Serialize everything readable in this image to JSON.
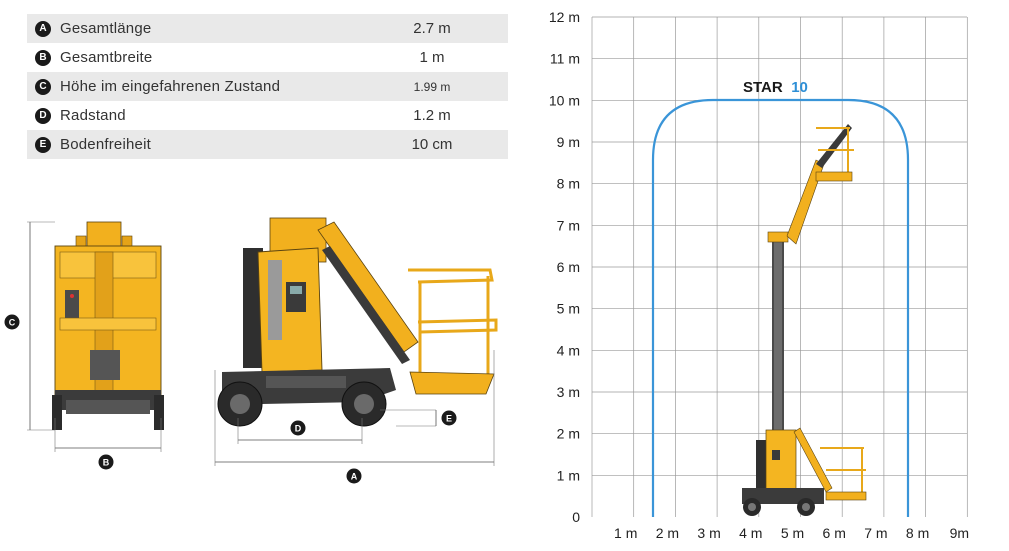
{
  "specs": [
    {
      "letter": "A",
      "label": "Gesamtlänge",
      "value": "2.7 m"
    },
    {
      "letter": "B",
      "label": "Gesamtbreite",
      "value": "1 m"
    },
    {
      "letter": "C",
      "label": "Höhe im eingefahrenen Zustand",
      "value": "1.99 m"
    },
    {
      "letter": "D",
      "label": "Radstand",
      "value": "1.2 m"
    },
    {
      "letter": "E",
      "label": "Bodenfreiheit",
      "value": "10 cm"
    }
  ],
  "dimension_markers": {
    "a": "A",
    "b": "B",
    "c": "C",
    "d": "D",
    "e": "E"
  },
  "chart": {
    "brand_name": "STAR",
    "brand_number": "10",
    "y_ticks": [
      "0",
      "1 m",
      "2 m",
      "3 m",
      "4 m",
      "5 m",
      "6 m",
      "7 m",
      "8 m",
      "9 m",
      "10 m",
      "11 m",
      "12 m"
    ],
    "x_ticks": [
      "1 m",
      "2 m",
      "3 m",
      "4 m",
      "5 m",
      "6 m",
      "7 m",
      "8 m",
      "9m"
    ],
    "colors": {
      "grid": "#9a9a9a",
      "envelope": "#3a95d8",
      "machine": "#f2b01e",
      "machine_dark": "#3b3b3b"
    }
  }
}
